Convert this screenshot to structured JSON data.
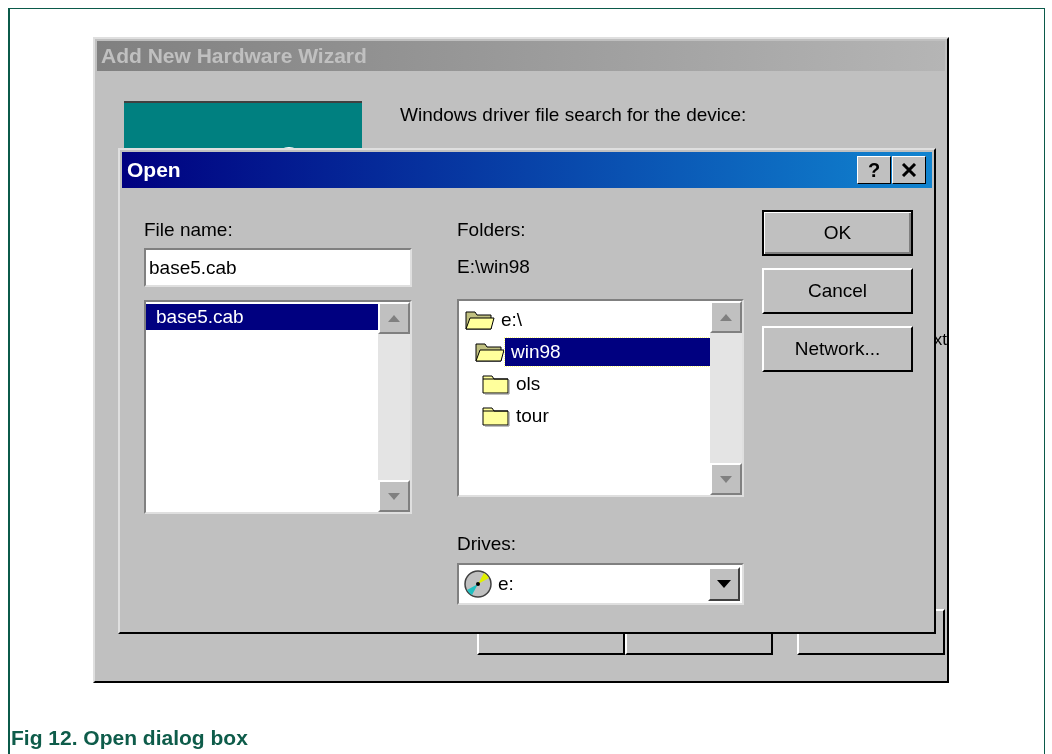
{
  "wizard": {
    "title": "Add New Hardware Wizard",
    "active": false,
    "prompt": "Windows driver file search for the device:",
    "fragment": "xt",
    "buttons_partly_hidden": true
  },
  "dialog": {
    "title": "Open",
    "active": true,
    "help_button": "?",
    "file_name": {
      "label": "File name:",
      "value": "base5.cab"
    },
    "files": [
      {
        "name": "base5.cab",
        "selected": true
      }
    ],
    "folders": {
      "label": "Folders:",
      "path": "E:\\win98",
      "items": [
        {
          "name": "e:\\",
          "kind": "open",
          "selected": false,
          "children": [
            {
              "name": "win98",
              "kind": "open",
              "selected": true,
              "children": [
                {
                  "name": "ols",
                  "kind": "closed",
                  "selected": false
                },
                {
                  "name": "tour",
                  "kind": "closed",
                  "selected": false
                }
              ]
            }
          ]
        }
      ]
    },
    "drives": {
      "label": "Drives:",
      "value": "e:"
    },
    "buttons": [
      {
        "label": "OK",
        "default": true
      },
      {
        "label": "Cancel",
        "default": false
      },
      {
        "label": "Network...",
        "default": false
      }
    ]
  },
  "figure": {
    "caption": "Fig 12. Open dialog box"
  }
}
